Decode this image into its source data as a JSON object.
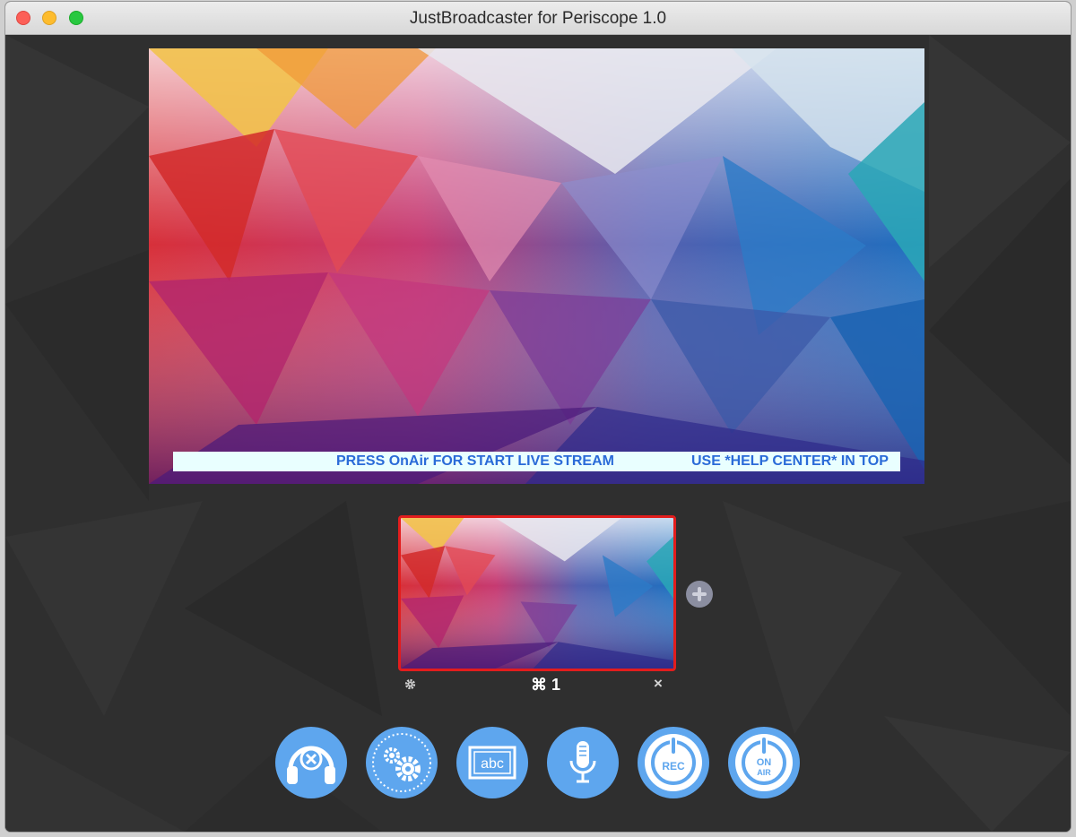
{
  "window": {
    "title": "JustBroadcaster for Periscope 1.0"
  },
  "preview": {
    "ticker_text_1": "PRESS  OnAir  FOR START LIVE STREAM",
    "ticker_text_2": "USE *HELP CENTER* IN TOP"
  },
  "scene": {
    "label": "⌘ 1",
    "close_glyph": "×"
  },
  "toolbar": {
    "buttons": [
      {
        "icon": "headphones-mute-icon"
      },
      {
        "icon": "gears-icon"
      },
      {
        "icon": "text-overlay-icon",
        "label": "abc"
      },
      {
        "icon": "microphone-icon"
      },
      {
        "icon": "record-power-icon",
        "label": "REC"
      },
      {
        "icon": "on-air-power-icon",
        "label_top": "ON",
        "label_bottom": "AIR"
      }
    ]
  },
  "colors": {
    "button_blue": "#5ea6ee",
    "scene_selected_border": "#e21d1d",
    "ticker_background": "#e9ffff",
    "ticker_text": "#2a6bd8"
  }
}
